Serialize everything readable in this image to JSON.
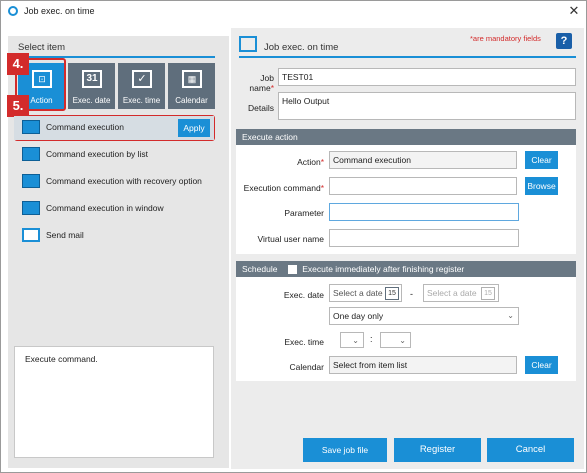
{
  "window": {
    "title": "Job exec. on time",
    "close_glyph": "✕"
  },
  "left": {
    "header": "Select item",
    "tabs": [
      {
        "label": "Action",
        "icon": "action-icon"
      },
      {
        "label": "Exec. date",
        "icon": "calendar-31-icon",
        "glyph": "31"
      },
      {
        "label": "Exec. time",
        "icon": "clock-check-icon"
      },
      {
        "label": "Calendar",
        "icon": "calendar-grid-icon"
      }
    ],
    "badges": [
      "4.",
      "5."
    ],
    "items": [
      {
        "label": "Command execution",
        "icon": "command-icon"
      },
      {
        "label": "Command execution by list",
        "icon": "command-list-icon"
      },
      {
        "label": "Command execution with recovery option",
        "icon": "command-recovery-icon"
      },
      {
        "label": "Command execution in window",
        "icon": "command-window-icon"
      },
      {
        "label": "Send mail",
        "icon": "mail-icon"
      }
    ],
    "apply_label": "Apply",
    "description": "Execute command."
  },
  "right": {
    "header": "Job exec. on time",
    "mandatory_note": "*are mandatory fields",
    "help_glyph": "?",
    "job_name_label": "Job name",
    "job_name_value": "TEST01",
    "details_label": "Details",
    "details_value": "Hello Output",
    "execute_action": {
      "section": "Execute action",
      "action_label": "Action",
      "action_value": "Command execution",
      "clear_label": "Clear",
      "command_label": "Execution command",
      "command_value": "",
      "browse_label": "Browse",
      "parameter_label": "Parameter",
      "parameter_value": "",
      "vuser_label": "Virtual user name",
      "vuser_value": ""
    },
    "schedule": {
      "section": "Schedule",
      "immediate_label": "Execute immediately after finishing register",
      "exec_date_label": "Exec. date",
      "date_from_placeholder": "Select a date",
      "date_separator": "-",
      "date_to_placeholder": "Select a date",
      "cal_glyph": "15",
      "frequency_value": "One day only",
      "exec_time_label": "Exec. time",
      "time_separator": ":",
      "calendar_label": "Calendar",
      "calendar_value": "Select from item list",
      "clear_label": "Clear"
    },
    "buttons": {
      "save": "Save job file",
      "register": "Register",
      "cancel": "Cancel"
    }
  },
  "colors": {
    "accent": "#1a8fd6",
    "tab_dark": "#5f6e7c",
    "callout_red": "#d32b2b",
    "section_header": "#6a7884"
  }
}
